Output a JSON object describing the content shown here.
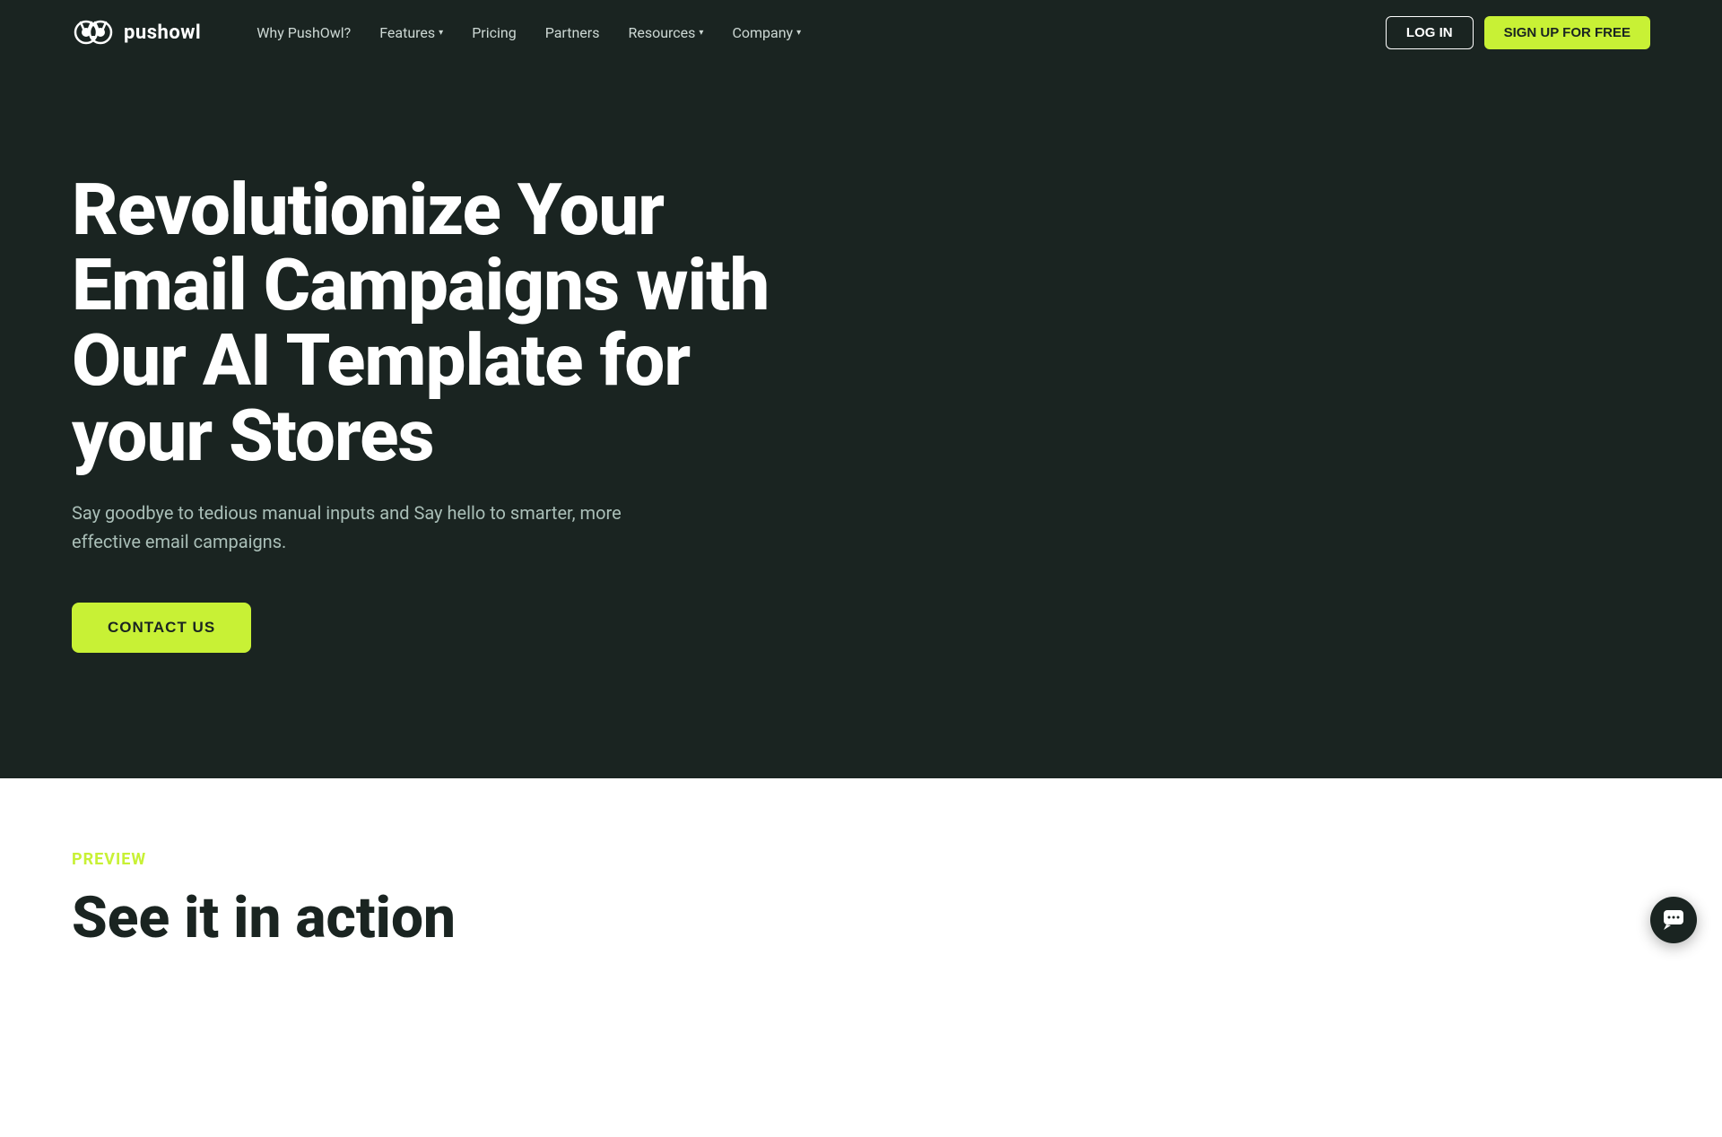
{
  "brand": {
    "name": "pushowl",
    "logo_alt": "PushOwl logo"
  },
  "navbar": {
    "why_pushowl": "Why PushOwl?",
    "features": "Features",
    "pricing": "Pricing",
    "partners": "Partners",
    "resources": "Resources",
    "company": "Company",
    "login_label": "LOG IN",
    "signup_label": "SIGN UP FOR FREE"
  },
  "hero": {
    "title": "Revolutionize Your Email Campaigns with Our AI Template for your Stores",
    "subtitle": "Say goodbye to tedious manual inputs and Say hello to smarter, more effective email campaigns.",
    "cta_label": "CONTACT US"
  },
  "preview_section": {
    "label": "PREVIEW",
    "title": "See it in action"
  },
  "colors": {
    "bg_dark": "#1a2421",
    "accent": "#c8f135",
    "text_light": "#ffffff",
    "text_muted": "#aabfb8"
  }
}
